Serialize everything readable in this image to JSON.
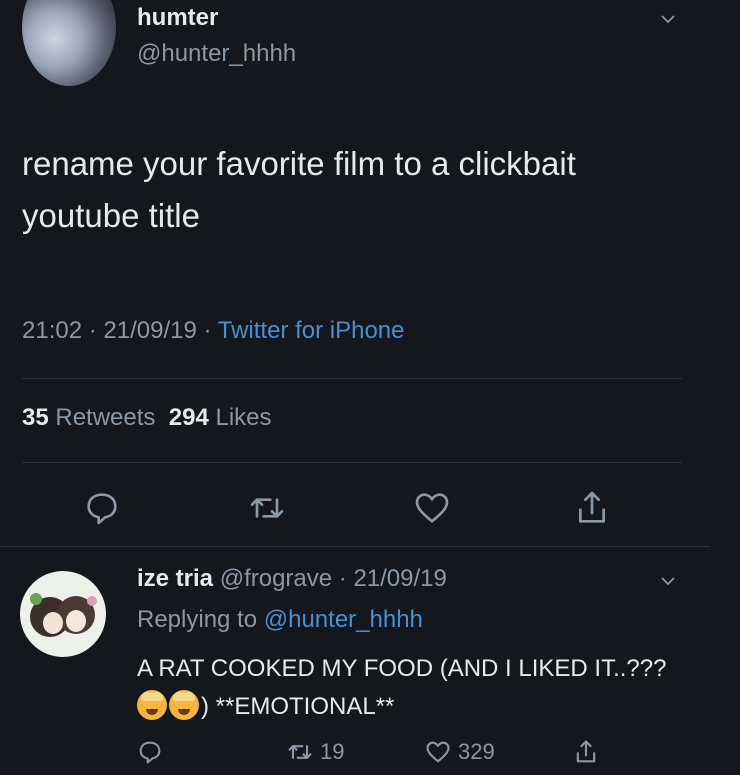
{
  "tweet": {
    "display_name": "humter",
    "handle": "@hunter_hhhh",
    "text": "rename your favorite film to a clickbait youtube title",
    "time": "21:02",
    "date": "21/09/19",
    "source": "Twitter for iPhone",
    "retweets_count": "35",
    "retweets_label": "Retweets",
    "likes_count": "294",
    "likes_label": "Likes"
  },
  "reply": {
    "display_name": "ize tria",
    "handle": "@frograve",
    "date": "21/09/19",
    "replying_label": "Replying to",
    "replying_handle": "@hunter_hhhh",
    "text_part1": "A RAT COOKED MY FOOD (AND I LIKED IT..???",
    "text_part2": ") **EMOTIONAL**",
    "retweets": "19",
    "likes": "329"
  },
  "colors": {
    "background": "#14171c",
    "accent": "#4a8fd1",
    "muted": "#8b98a5"
  },
  "icons": [
    "reply-icon",
    "retweet-icon",
    "like-icon",
    "share-icon",
    "chevron-down-icon"
  ]
}
